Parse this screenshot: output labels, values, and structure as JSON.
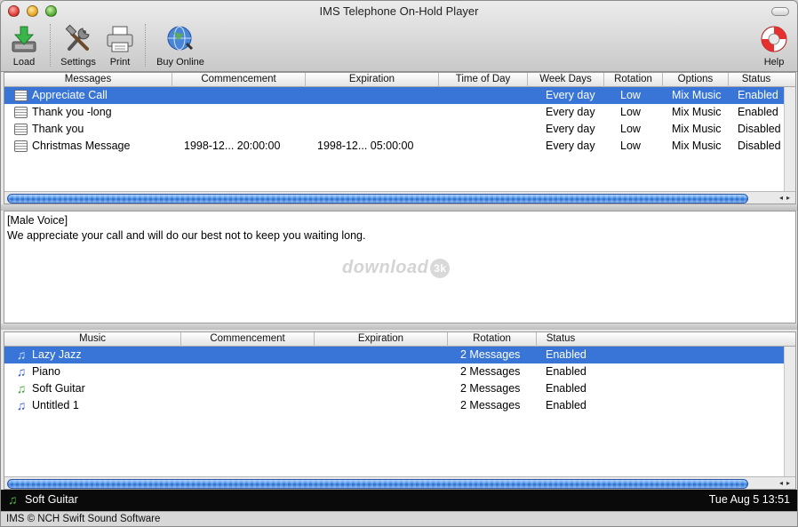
{
  "window": {
    "title": "IMS Telephone On-Hold Player"
  },
  "toolbar": {
    "load": "Load",
    "settings": "Settings",
    "print": "Print",
    "buy_online": "Buy Online",
    "help": "Help"
  },
  "messages_table": {
    "columns": [
      "Messages",
      "Commencement",
      "Expiration",
      "Time of Day",
      "Week Days",
      "Rotation",
      "Options",
      "Status"
    ],
    "rows": [
      {
        "name": "Appreciate Call",
        "commencement": "",
        "expiration": "",
        "time_of_day": "",
        "week_days": "Every day",
        "rotation": "Low",
        "options": "Mix Music",
        "status": "Enabled"
      },
      {
        "name": "Thank you -long",
        "commencement": "",
        "expiration": "",
        "time_of_day": "",
        "week_days": "Every day",
        "rotation": "Low",
        "options": "Mix Music",
        "status": "Enabled"
      },
      {
        "name": "Thank you",
        "commencement": "",
        "expiration": "",
        "time_of_day": "",
        "week_days": "Every day",
        "rotation": "Low",
        "options": "Mix Music",
        "status": "Disabled"
      },
      {
        "name": "Christmas Message",
        "commencement": "1998-12... 20:00:00",
        "expiration": "1998-12... 05:00:00",
        "time_of_day": "",
        "week_days": "Every day",
        "rotation": "Low",
        "options": "Mix Music",
        "status": "Disabled"
      }
    ]
  },
  "message_text": {
    "line1": "[Male Voice]",
    "line2": "We appreciate your call and will do our best not to keep you waiting long."
  },
  "watermark": {
    "text": "download",
    "badge": "3k"
  },
  "music_table": {
    "columns": [
      "Music",
      "Commencement",
      "Expiration",
      "Rotation",
      "Status"
    ],
    "rows": [
      {
        "name": "Lazy Jazz",
        "commencement": "",
        "expiration": "",
        "rotation": "2 Messages",
        "status": "Enabled"
      },
      {
        "name": "Piano",
        "commencement": "",
        "expiration": "",
        "rotation": "2 Messages",
        "status": "Enabled"
      },
      {
        "name": "Soft Guitar",
        "commencement": "",
        "expiration": "",
        "rotation": "2 Messages",
        "status": "Enabled"
      },
      {
        "name": "Untitled 1",
        "commencement": "",
        "expiration": "",
        "rotation": "2 Messages",
        "status": "Enabled"
      }
    ]
  },
  "status_bar": {
    "now_playing": "Soft Guitar",
    "datetime": "Tue Aug  5 13:51"
  },
  "footer": {
    "text": "IMS © NCH Swift Sound Software"
  },
  "colors": {
    "selection": "#3875d7",
    "status_bar": "#0a0a0a"
  }
}
